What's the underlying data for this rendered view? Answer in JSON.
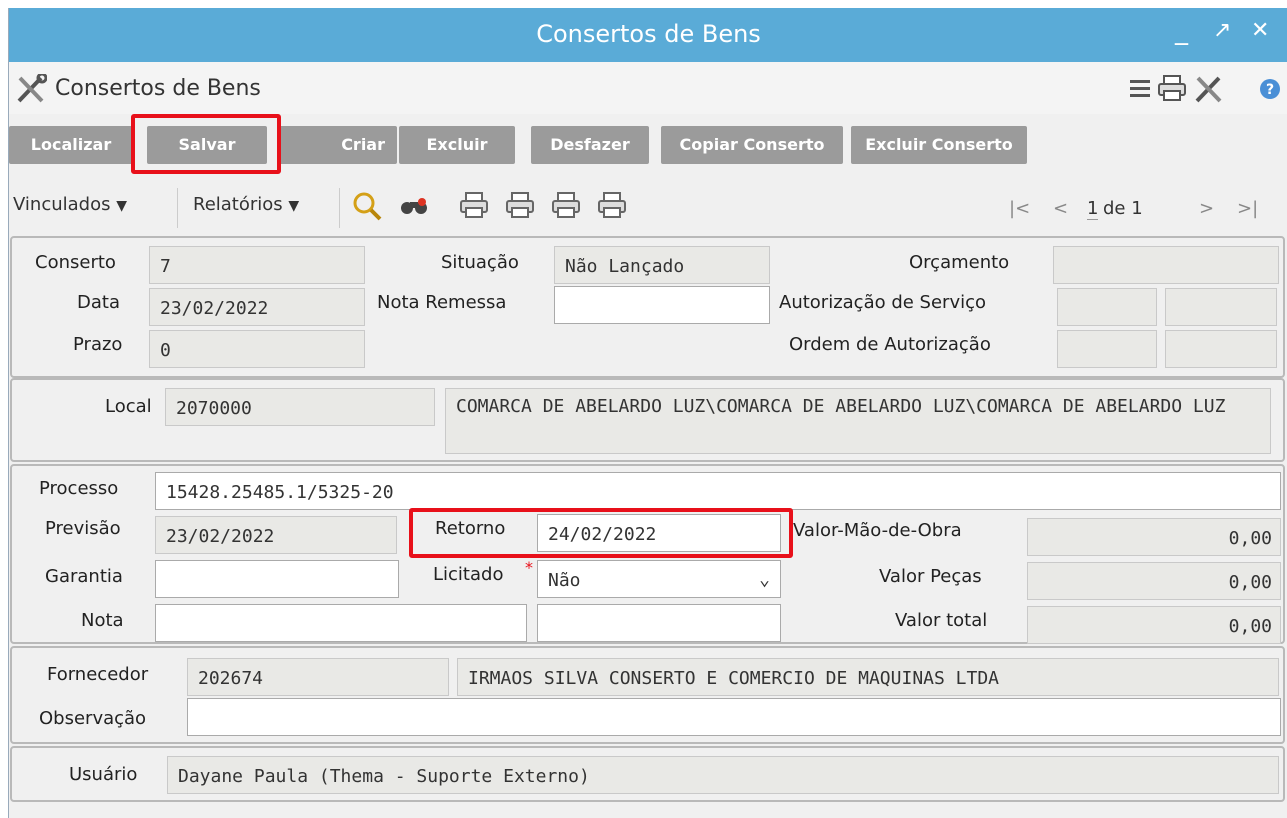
{
  "window": {
    "title": "Consertos de Bens"
  },
  "header": {
    "title": "Consertos de Bens"
  },
  "toolbar": {
    "buttons": [
      "Localizar",
      "Salvar",
      "Criar",
      "Excluir",
      "Desfazer",
      "Copiar Conserto",
      "Excluir Conserto"
    ],
    "vinculados": "Vinculados",
    "relatorios": "Relatórios"
  },
  "pager": {
    "current": "1",
    "of_text": "de 1"
  },
  "section1": {
    "conserto_label": "Conserto",
    "conserto": "7",
    "data_label": "Data",
    "data": "23/02/2022",
    "prazo_label": "Prazo",
    "prazo": "0",
    "situacao_label": "Situação",
    "situacao": "Não Lançado",
    "nota_remessa_label": "Nota Remessa",
    "nota_remessa": "",
    "orcamento_label": "Orçamento",
    "orcamento": "",
    "autorizacao_label": "Autorização de Serviço",
    "ordem_label": "Ordem de Autorização"
  },
  "section2": {
    "local_label": "Local",
    "local_code": "2070000",
    "local_desc": "COMARCA DE ABELARDO LUZ\\COMARCA DE ABELARDO LUZ\\COMARCA DE ABELARDO LUZ"
  },
  "section3": {
    "processo_label": "Processo",
    "processo": "15428.25485.1/5325-20",
    "previsao_label": "Previsão",
    "previsao": "23/02/2022",
    "retorno_label": "Retorno",
    "retorno": "24/02/2022",
    "garantia_label": "Garantia",
    "garantia": "",
    "licitado_label": "Licitado",
    "required_mark": "*",
    "licitado": "Não",
    "nota_label": "Nota",
    "nota": "",
    "valor_mao_label": "Valor-Mão-de-Obra",
    "valor_mao": "0,00",
    "valor_pecas_label": "Valor Peças",
    "valor_pecas": "0,00",
    "valor_total_label": "Valor total",
    "valor_total": "0,00"
  },
  "section4": {
    "fornecedor_label": "Fornecedor",
    "fornecedor_code": "202674",
    "fornecedor_name": "IRMAOS SILVA CONSERTO E COMERCIO DE MAQUINAS LTDA",
    "observacao_label": "Observação",
    "observacao": ""
  },
  "section5": {
    "usuario_label": "Usuário",
    "usuario": "Dayane Paula (Thema - Suporte Externo)"
  },
  "colors": {
    "titlebar": "#5aabd7",
    "button": "#9b9b9b",
    "highlight": "#e8101a"
  },
  "icons": [
    "tools-icon",
    "menu-icon",
    "printer-icon",
    "help-icon",
    "search-icon",
    "binoculars-icon"
  ]
}
